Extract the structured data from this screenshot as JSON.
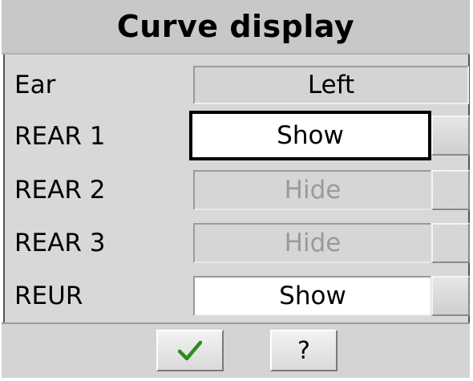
{
  "title": "Curve display",
  "rows": [
    {
      "label": "Ear",
      "value": "Left"
    },
    {
      "label": "REAR 1",
      "value": "Show",
      "state": "enabled",
      "focused": true
    },
    {
      "label": "REAR 2",
      "value": "Hide",
      "state": "disabled"
    },
    {
      "label": "REAR 3",
      "value": "Hide",
      "state": "disabled"
    },
    {
      "label": "REUR",
      "value": "Show",
      "state": "enabled"
    }
  ],
  "footer": {
    "ok_icon": "checkmark-icon",
    "ok_icon_color": "#2e8b1e",
    "help_label": "?"
  }
}
